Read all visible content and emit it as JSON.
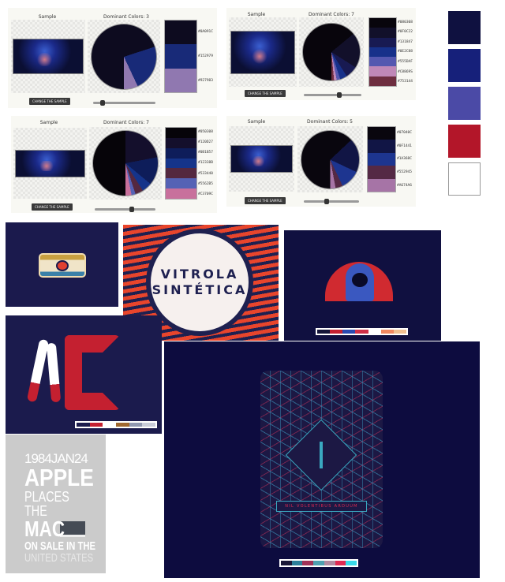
{
  "panels": [
    {
      "sample_label": "Sample",
      "dominant_label": "Dominant Colors: 3",
      "button": "CHANGE THE SAMPLE",
      "slider_value": 0.12,
      "colors": [
        "#0A091C",
        "#152979",
        "#927983"
      ],
      "swatch": [
        "#0d0b1f",
        "#182a78",
        "#9078b0"
      ],
      "shares": [
        0.7,
        0.23,
        0.07
      ]
    },
    {
      "sample_label": "Sample",
      "dominant_label": "Dominant Colors: 7",
      "button": "CHANGE THE SAMPLE",
      "slider_value": 0.62,
      "colors": [
        "#080308",
        "#0F0C22",
        "#131847",
        "#0E2C88",
        "#555DAF",
        "#C8869S",
        "#753144"
      ],
      "swatch": [
        "#08050c",
        "#12102a",
        "#181a52",
        "#17318a",
        "#5558b0",
        "#c088b8",
        "#6e2e40"
      ],
      "shares": [
        0.64,
        0.2,
        0.07,
        0.04,
        0.02,
        0.015,
        0.015
      ]
    },
    {
      "sample_label": "Sample",
      "dominant_label": "Dominant Colors: 7",
      "button": "CHANGE THE SAMPLE",
      "slider_value": 0.62,
      "colors": [
        "#050308",
        "#120D27",
        "#0B1B57",
        "#12338B",
        "#533440",
        "#5562B5",
        "#C3709C"
      ],
      "swatch": [
        "#060409",
        "#140f2c",
        "#0e1d5a",
        "#15348a",
        "#54283f",
        "#5562b5",
        "#c8709c"
      ],
      "shares": [
        0.5,
        0.22,
        0.14,
        0.05,
        0.04,
        0.02,
        0.03
      ]
    },
    {
      "sample_label": "Sample",
      "dominant_label": "Dominant Colors: 5",
      "button": "CHANGE THE SAMPLE",
      "slider_value": 0.4,
      "colors": [
        "#07040C",
        "#0F1441",
        "#1A368C",
        "#552945",
        "#A674A6"
      ],
      "swatch": [
        "#09060e",
        "#111545",
        "#1d3590",
        "#552945",
        "#a674a6"
      ],
      "shares": [
        0.63,
        0.19,
        0.11,
        0.04,
        0.03
      ]
    }
  ],
  "swatches": [
    "#0f1140",
    "#16207a",
    "#4b4aa6",
    "#b31629",
    "#ffffff"
  ],
  "art": {
    "vitrola": {
      "line1": "VITROLA",
      "line2": "SINTÉTICA"
    },
    "apple": {
      "l1": "1984JAN24",
      "l2": "APPLE",
      "l3": "PLACES THE",
      "l4": "MAC",
      "l5": "ON SALE IN THE",
      "l6": "UNITED STATES"
    },
    "nil": {
      "motto": "NIL VOLENTIBUS ARDUUM",
      "palette": [
        "#1a1838",
        "#2c7f9a",
        "#a03258",
        "#4ea0b0",
        "#b08aa0",
        "#e02a52",
        "#38d8e8"
      ]
    },
    "hooded": {
      "palette": [
        "#151538",
        "#c42030",
        "#2a4ab0",
        "#d03048",
        "#ffffff",
        "#f08860",
        "#f0c090"
      ]
    },
    "cleveland": {
      "palette": [
        "#1b1b4d",
        "#c42030",
        "#ffffff",
        "#a06830",
        "#9098b0",
        "#c8ccd8"
      ]
    }
  }
}
